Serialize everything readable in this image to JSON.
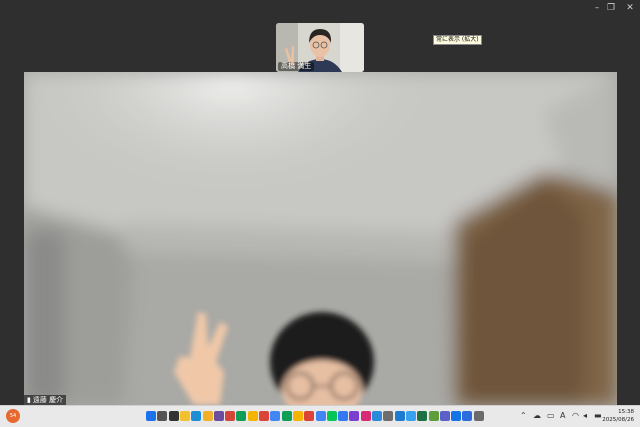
{
  "window": {
    "controls": [
      "–",
      "❐",
      "✕"
    ]
  },
  "participants": {
    "top_name": "高橋 満生",
    "main_name": "遠藤 慶介"
  },
  "tooltip": "常に表示 (拡大)",
  "taskbar": {
    "weather_badge": "54",
    "time": "15:38",
    "date": "2025/08/26",
    "tray_icons": [
      "chevron-up-icon",
      "cloud-icon",
      "network-icon",
      "font-icon",
      "wifi-icon",
      "speaker-icon",
      "battery-icon"
    ],
    "app_icons": [
      {
        "name": "start-icon",
        "color": "#1a73e8"
      },
      {
        "name": "search-icon",
        "color": "#555555"
      },
      {
        "name": "task-view-icon",
        "color": "#333333"
      },
      {
        "name": "explorer-icon",
        "color": "#f2c12e"
      },
      {
        "name": "edge-icon",
        "color": "#1d8fd6"
      },
      {
        "name": "files-icon",
        "color": "#f0b02a"
      },
      {
        "name": "app-icon",
        "color": "#6b4ea0"
      },
      {
        "name": "chrome-icon",
        "color": "#d44638"
      },
      {
        "name": "chrome-icon",
        "color": "#0f9d58"
      },
      {
        "name": "chrome-icon",
        "color": "#f4b400"
      },
      {
        "name": "chrome-icon",
        "color": "#db4437"
      },
      {
        "name": "chrome-icon",
        "color": "#4285f4"
      },
      {
        "name": "chrome-icon",
        "color": "#0f9d58"
      },
      {
        "name": "chrome-icon",
        "color": "#f4b400"
      },
      {
        "name": "chrome-icon",
        "color": "#db4437"
      },
      {
        "name": "chrome-icon",
        "color": "#4285f4"
      },
      {
        "name": "line-icon",
        "color": "#06c755"
      },
      {
        "name": "chat-icon",
        "color": "#3478f6"
      },
      {
        "name": "app-icon",
        "color": "#7a3fd0"
      },
      {
        "name": "instagram-icon",
        "color": "#d62976"
      },
      {
        "name": "app-icon",
        "color": "#2a8bd8"
      },
      {
        "name": "settings-icon",
        "color": "#6d6d6d"
      },
      {
        "name": "photos-icon",
        "color": "#1f7ad1"
      },
      {
        "name": "app-icon",
        "color": "#3aa1f1"
      },
      {
        "name": "excel-icon",
        "color": "#1d7044"
      },
      {
        "name": "app-icon",
        "color": "#5e9e3a"
      },
      {
        "name": "teams-icon",
        "color": "#5b5fc7"
      },
      {
        "name": "app-icon",
        "color": "#1473e6"
      },
      {
        "name": "app-icon",
        "color": "#2d6cdf"
      },
      {
        "name": "app-icon",
        "color": "#6b6b6b"
      }
    ]
  }
}
